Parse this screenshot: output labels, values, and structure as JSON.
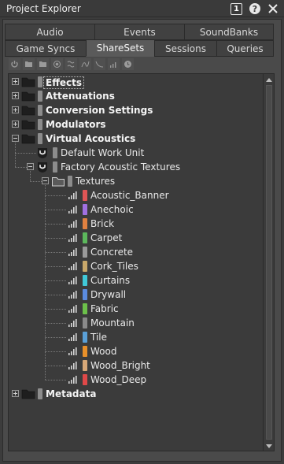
{
  "window": {
    "title": "Project Explorer"
  },
  "tabs": {
    "row1": [
      {
        "label": "Audio"
      },
      {
        "label": "Events"
      },
      {
        "label": "SoundBanks"
      }
    ],
    "row2": [
      {
        "label": "Game Syncs"
      },
      {
        "label": "ShareSets",
        "active": true
      },
      {
        "label": "Sessions"
      },
      {
        "label": "Queries"
      }
    ]
  },
  "toolbar": {
    "tools": [
      {
        "icon": "power-icon"
      },
      {
        "icon": "folder-icon"
      },
      {
        "icon": "folder-open-icon"
      },
      {
        "icon": "target-icon"
      },
      {
        "icon": "conversion-icon"
      },
      {
        "icon": "curve-icon"
      },
      {
        "icon": "attenuation-icon"
      },
      {
        "icon": "texture-bars-icon"
      },
      {
        "icon": "clock-icon"
      }
    ]
  },
  "tree": {
    "items": [
      {
        "label": "Effects",
        "bold": true,
        "selected": true,
        "expander": "plus",
        "icon": "folder-icon"
      },
      {
        "label": "Attenuations",
        "bold": true,
        "expander": "plus",
        "icon": "folder-icon"
      },
      {
        "label": "Conversion Settings",
        "bold": true,
        "expander": "plus",
        "icon": "folder-icon"
      },
      {
        "label": "Modulators",
        "bold": true,
        "expander": "plus",
        "icon": "folder-icon"
      },
      {
        "label": "Virtual Acoustics",
        "bold": true,
        "expander": "minus",
        "icon": "folder-icon"
      },
      {
        "label": "Default Work Unit",
        "icon": "work-unit-icon"
      },
      {
        "label": "Factory Acoustic Textures",
        "expander": "minus",
        "icon": "work-unit-icon"
      },
      {
        "label": "Textures",
        "expander": "minus",
        "icon": "folder-outline-icon"
      },
      {
        "label": "Acoustic_Banner",
        "color": "#e05555",
        "icon": "texture-bars-icon"
      },
      {
        "label": "Anechoic",
        "color": "#a070e0",
        "icon": "texture-bars-icon"
      },
      {
        "label": "Brick",
        "color": "#e08040",
        "icon": "texture-bars-icon"
      },
      {
        "label": "Carpet",
        "color": "#5cb85c",
        "icon": "texture-bars-icon"
      },
      {
        "label": "Concrete",
        "color": "#9a9a9a",
        "icon": "texture-bars-icon"
      },
      {
        "label": "Cork_Tiles",
        "color": "#c9a86a",
        "icon": "texture-bars-icon"
      },
      {
        "label": "Curtains",
        "color": "#40c8d8",
        "icon": "texture-bars-icon"
      },
      {
        "label": "Drywall",
        "color": "#5a8be0",
        "icon": "texture-bars-icon"
      },
      {
        "label": "Fabric",
        "color": "#6cc04a",
        "icon": "texture-bars-icon"
      },
      {
        "label": "Mountain",
        "color": "#8a8a8a",
        "icon": "texture-bars-icon"
      },
      {
        "label": "Tile",
        "color": "#5aa0d8",
        "icon": "texture-bars-icon"
      },
      {
        "label": "Wood",
        "color": "#e8902a",
        "icon": "texture-bars-icon"
      },
      {
        "label": "Wood_Bright",
        "color": "#d8a878",
        "icon": "texture-bars-icon"
      },
      {
        "label": "Wood_Deep",
        "color": "#e04848",
        "icon": "texture-bars-icon"
      },
      {
        "label": "Metadata",
        "bold": true,
        "expander": "plus",
        "icon": "folder-icon"
      }
    ]
  },
  "colors": {
    "folder_swatch": "#8c8c8c",
    "background": "#3b3b3b"
  }
}
